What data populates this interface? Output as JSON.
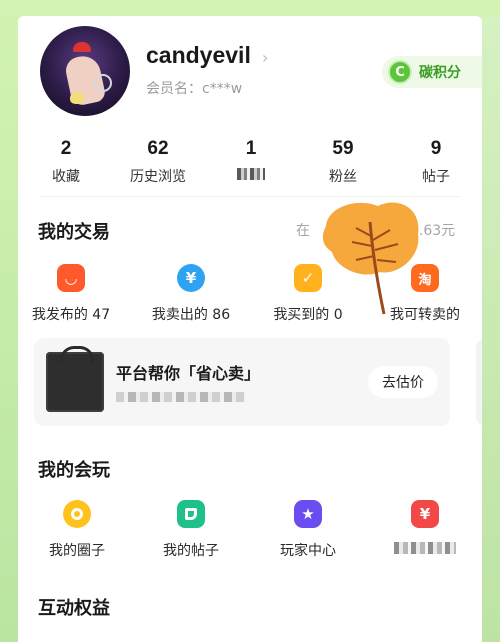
{
  "profile": {
    "username": "candyevil",
    "member_label": "会员名：c***w",
    "carbon_badge": {
      "icon": "C",
      "label": "碳积分"
    }
  },
  "stats": [
    {
      "value": "2",
      "label": "收藏"
    },
    {
      "value": "62",
      "label": "历史浏览"
    },
    {
      "value": "1",
      "label": ""
    },
    {
      "value": "59",
      "label": "粉丝"
    },
    {
      "value": "9",
      "label": "帖子"
    }
  ],
  "trade": {
    "title": "我的交易",
    "right_text": "在",
    "right_amount": "4.63元",
    "items": [
      {
        "icon": "bag-icon",
        "glyph": "◡",
        "color": "#ff5a2c",
        "label": "我发布的 47"
      },
      {
        "icon": "yuan-icon",
        "glyph": "¥",
        "color": "#2ea3f2",
        "label": "我卖出的 86"
      },
      {
        "icon": "check-doc-icon",
        "glyph": "✓",
        "color": "#ffb21e",
        "label": "我买到的 0"
      },
      {
        "icon": "taobao-icon",
        "glyph": "淘",
        "color": "#ff6a1f",
        "label": "我可转卖的"
      }
    ]
  },
  "sell_card": {
    "title": "平台帮你「省心卖」",
    "button": "去估价"
  },
  "play": {
    "title": "我的会玩",
    "items": [
      {
        "icon": "circle-icon",
        "glyph": "○",
        "color": "#ffc21a",
        "label": "我的圈子"
      },
      {
        "icon": "post-icon",
        "glyph": "▬",
        "color": "#20c08a",
        "label": "我的帖子"
      },
      {
        "icon": "star-icon",
        "glyph": "★",
        "color": "#6a4cf0",
        "label": "玩家中心"
      },
      {
        "icon": "yuan-tag-icon",
        "glyph": "¥",
        "color": "#f24848",
        "label": ""
      }
    ]
  },
  "benefits": {
    "title": "互动权益"
  },
  "colors": {
    "accent_green": "#5cc53a",
    "background": "#c6ecb0"
  }
}
